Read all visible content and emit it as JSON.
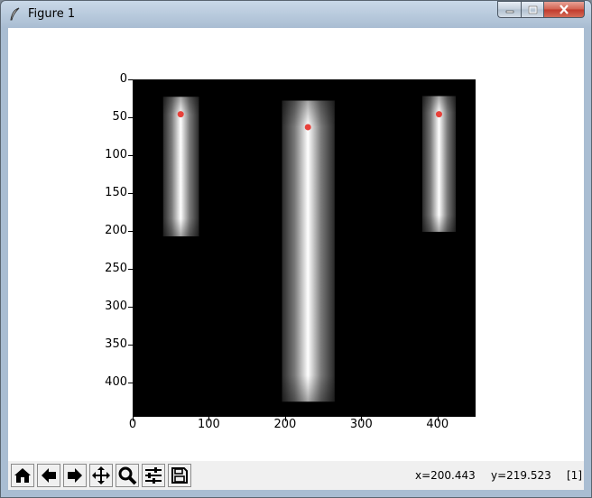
{
  "window": {
    "title": "Figure 1"
  },
  "toolbar": {
    "buttons": [
      {
        "name": "home",
        "icon": "home-icon"
      },
      {
        "name": "back",
        "icon": "arrow-left-icon"
      },
      {
        "name": "forward",
        "icon": "arrow-right-icon"
      },
      {
        "name": "pan",
        "icon": "move-icon"
      },
      {
        "name": "zoom",
        "icon": "magnifier-icon"
      },
      {
        "name": "configure",
        "icon": "sliders-icon"
      },
      {
        "name": "save",
        "icon": "floppy-disk-icon"
      }
    ],
    "x_readout": "x=200.443",
    "y_readout": "y=219.523",
    "value_readout": "[1]"
  },
  "chart_data": {
    "type": "image",
    "xlim": [
      0,
      450
    ],
    "ylim": [
      445,
      0
    ],
    "x_ticks": [
      "0",
      "100",
      "200",
      "300",
      "400"
    ],
    "y_ticks": [
      "0",
      "50",
      "100",
      "150",
      "200",
      "250",
      "300",
      "350",
      "400"
    ],
    "background_color": "#000000",
    "shapes": [
      {
        "kind": "gradient-bar",
        "x": [
          40,
          87
        ],
        "y": [
          23,
          207
        ],
        "peak_x": 63
      },
      {
        "kind": "gradient-bar",
        "x": [
          196,
          265
        ],
        "y": [
          28,
          425
        ],
        "peak_x": 230
      },
      {
        "kind": "gradient-bar",
        "x": [
          380,
          424
        ],
        "y": [
          22,
          201
        ],
        "peak_x": 402
      }
    ],
    "points": [
      {
        "x": 63,
        "y": 46
      },
      {
        "x": 230,
        "y": 63
      },
      {
        "x": 402,
        "y": 46
      }
    ],
    "point_color": "#e8413a"
  }
}
